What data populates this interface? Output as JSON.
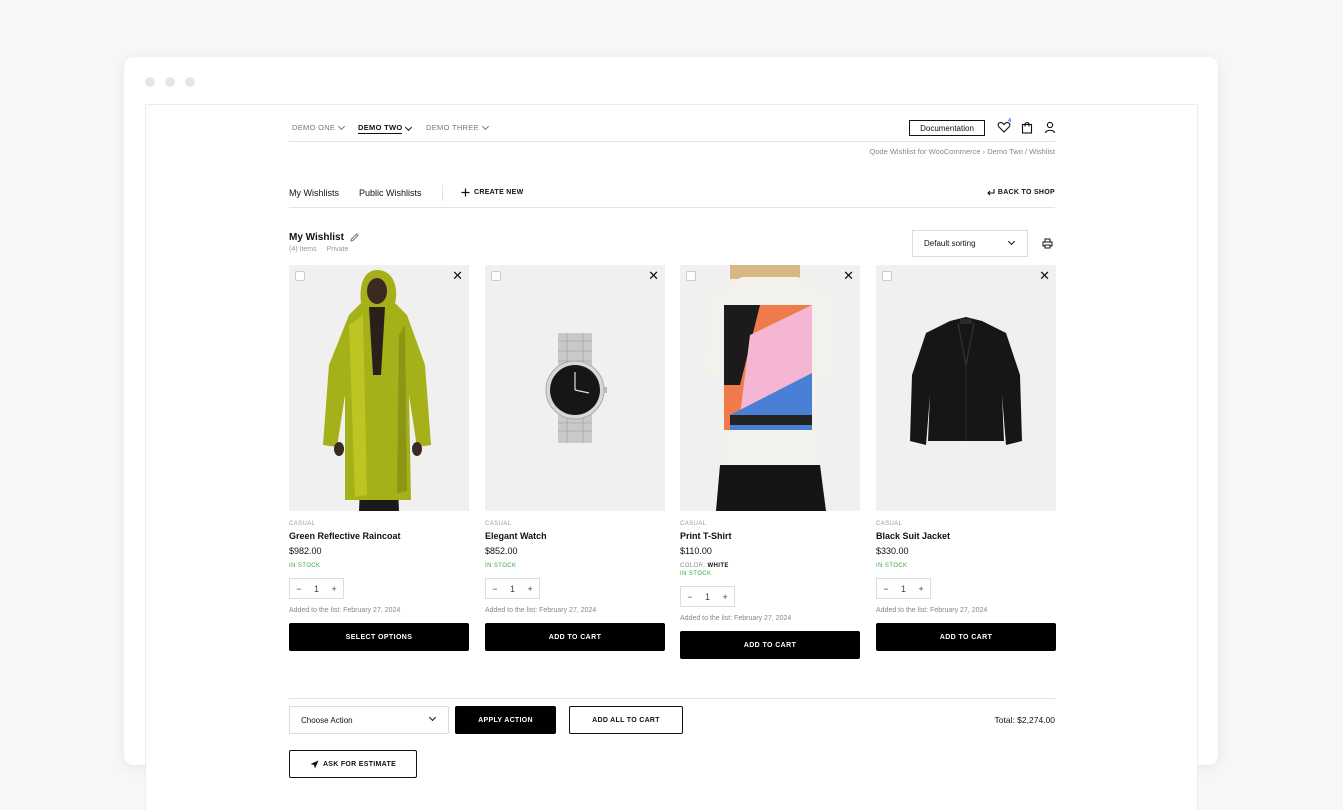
{
  "nav": {
    "items": [
      {
        "label": "DEMO ONE"
      },
      {
        "label": "DEMO TWO"
      },
      {
        "label": "DEMO THREE"
      }
    ],
    "documentation": "Documentation",
    "wishlist_count": "4",
    "icons": [
      "heart-icon",
      "bag-icon",
      "user-icon"
    ]
  },
  "breadcrumb": "Qode Wishlist for WooCommerce › Demo Two  /  Wishlist",
  "subnav": {
    "my_wishlists": "My Wishlists",
    "public_wishlists": "Public Wishlists",
    "create_new": "CREATE NEW",
    "back_to_shop": "BACK TO SHOP"
  },
  "wishlist": {
    "title": "My Wishlist",
    "count": "(4) Items",
    "visibility": "Private",
    "sorting": "Default sorting"
  },
  "products": [
    {
      "category": "CASUAL",
      "name": "Green Reflective Raincoat",
      "price": "$982.00",
      "stock": "IN STOCK",
      "qty": "1",
      "added": "Added to the list: February 27, 2024",
      "button": "SELECT OPTIONS"
    },
    {
      "category": "CASUAL",
      "name": "Elegant Watch",
      "price": "$852.00",
      "stock": "IN STOCK",
      "qty": "1",
      "added": "Added to the list: February 27, 2024",
      "button": "ADD TO CART"
    },
    {
      "category": "CASUAL",
      "name": "Print T-Shirt",
      "price": "$110.00",
      "attr_label": "COLOR:",
      "attr_value": "WHITE",
      "stock": "IN STOCK",
      "qty": "1",
      "added": "Added to the list: February 27, 2024",
      "button": "ADD TO CART"
    },
    {
      "category": "CASUAL",
      "name": "Black Suit Jacket",
      "price": "$330.00",
      "stock": "IN STOCK",
      "qty": "1",
      "added": "Added to the list: February 27, 2024",
      "button": "ADD TO CART"
    }
  ],
  "footer": {
    "choose_action": "Choose Action",
    "apply_action": "APPLY ACTION",
    "add_all": "ADD ALL TO CART",
    "total": "Total: $2,274.00",
    "ask_estimate": "ASK FOR ESTIMATE"
  },
  "colors": {
    "accent": "#000000",
    "stock": "#3aa843",
    "badge": "#2f6bff"
  }
}
